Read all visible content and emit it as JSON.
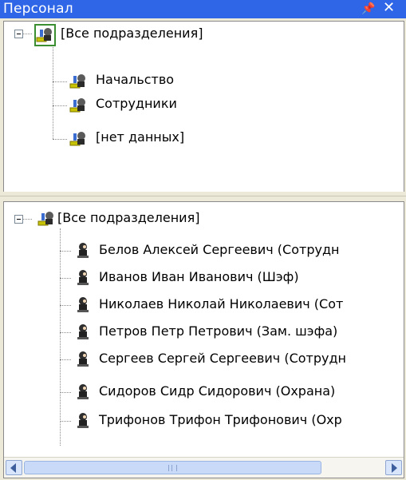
{
  "window": {
    "title": "Персонал"
  },
  "title_buttons": {
    "pin_icon": "pin-icon",
    "close_icon": "close-icon"
  },
  "departments_tree": {
    "root": {
      "label": "[Все подразделения]",
      "expanded": true,
      "selected": true
    },
    "items": [
      {
        "label": "Начальство"
      },
      {
        "label": "Сотрудники"
      },
      {
        "label": "[нет данных]"
      }
    ]
  },
  "employees_tree": {
    "root": {
      "label": "[Все подразделения]",
      "expanded": true
    },
    "items": [
      {
        "label": "Белов Алексей Сергеевич (Сотрудн"
      },
      {
        "label": "Иванов Иван Иванович (Шэф)"
      },
      {
        "label": "Николаев Николай Николаевич (Сот"
      },
      {
        "label": "Петров Петр Петрович (Зам. шэфа)"
      },
      {
        "label": "Сергеев Сергей Сергеевич (Сотрудн"
      },
      {
        "label": "Сидоров Сидр Сидорович (Охрана)"
      },
      {
        "label": "Трифонов Трифон Трифонович (Охр"
      }
    ]
  },
  "scrollbar": {
    "orientation": "horizontal",
    "position": 0.0
  },
  "colors": {
    "title_bar": "#2f66e8",
    "selection_border": "#3b8f32",
    "panel_bg": "#ece9d8"
  }
}
